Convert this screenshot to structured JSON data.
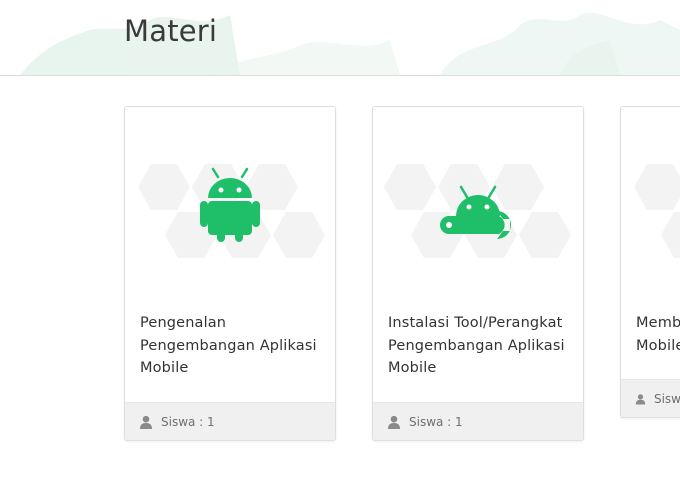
{
  "page": {
    "title": "Materi"
  },
  "colors": {
    "accent": "#1fbf6a",
    "hex_fill": "#f2f2f2",
    "footer_bg": "#f0f0f0"
  },
  "courses": [
    {
      "icon": "android-robot-icon",
      "title_lines": [
        "Pengenalan",
        "Pengembangan Aplikasi",
        "Mobile"
      ],
      "students_label": "Siswa : 1"
    },
    {
      "icon": "android-wrench-icon",
      "title_lines": [
        "Instalasi Tool/Perangkat",
        "Pengembangan Aplikasi",
        "Mobile"
      ],
      "students_label": "Siswa : 1"
    },
    {
      "icon": "",
      "title_lines": [
        "Memb",
        "Mobile"
      ],
      "students_label": "Sisw"
    }
  ]
}
